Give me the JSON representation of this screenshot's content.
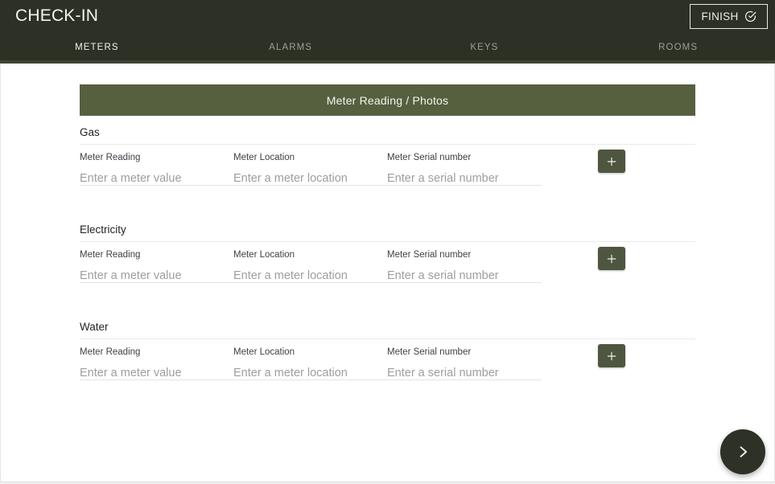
{
  "header": {
    "title": "CHECK-IN",
    "finish_button": {
      "label": "FINISH",
      "icon": "check-circle-icon"
    }
  },
  "tabs": [
    {
      "label": "METERS",
      "active": true
    },
    {
      "label": "ALARMS",
      "active": false
    },
    {
      "label": "KEYS",
      "active": false
    },
    {
      "label": "ROOMS",
      "active": false
    }
  ],
  "banner": {
    "label": "Meter Reading / Photos"
  },
  "field_labels": {
    "reading": "Meter Reading",
    "location": "Meter Location",
    "serial": "Meter Serial number"
  },
  "field_placeholders": {
    "reading": "Enter a meter value",
    "location": "Enter a meter location",
    "serial": "Enter a serial number"
  },
  "field_values": {
    "reading": "",
    "location": "",
    "serial": ""
  },
  "groups": [
    {
      "title": "Gas",
      "add_button_label": "+",
      "add_button_icon": "plus-icon"
    },
    {
      "title": "Electricity",
      "add_button_label": "+",
      "add_button_icon": "plus-icon"
    },
    {
      "title": "Water",
      "add_button_label": "+",
      "add_button_icon": "plus-icon"
    }
  ],
  "fab": {
    "icon": "chevron-right-icon"
  },
  "colors": {
    "topbar": "#2c3025",
    "banner": "#56603F",
    "add_button": "#4E5640",
    "fab": "#2D3126",
    "active_tab_underline": "#3D4434"
  }
}
